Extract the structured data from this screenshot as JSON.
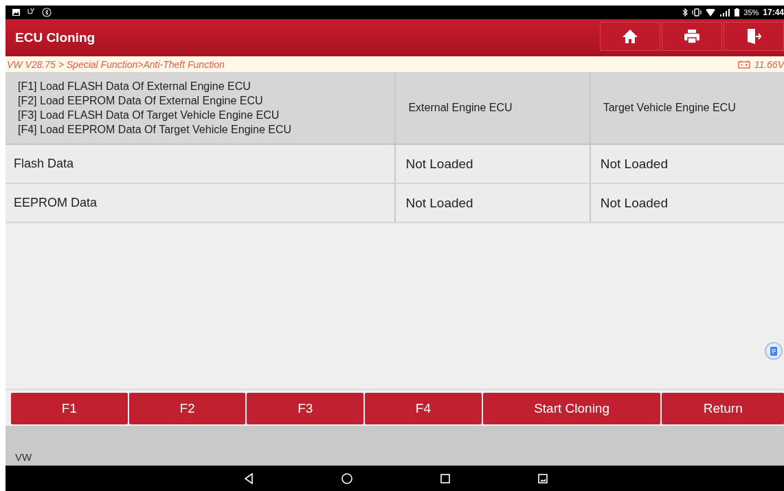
{
  "status_bar": {
    "battery": "35%",
    "time": "17:44"
  },
  "header": {
    "title": "ECU Cloning"
  },
  "breadcrumb": {
    "path": "VW V28.75 > Special Function>Anti-Theft Function",
    "voltage": "11.66V"
  },
  "table": {
    "header": {
      "lines": [
        "[F1] Load FLASH Data Of External Engine ECU",
        "[F2] Load EEPROM Data Of External Engine ECU",
        "[F3] Load FLASH Data Of Target Vehicle Engine ECU",
        "[F4] Load EEPROM Data Of Target Vehicle Engine ECU"
      ],
      "columns": [
        "External Engine ECU",
        "Target Vehicle Engine ECU"
      ]
    },
    "rows": [
      {
        "cells": [
          "Flash Data",
          "Not Loaded",
          "Not Loaded"
        ]
      },
      {
        "cells": [
          "EEPROM Data",
          "Not Loaded",
          "Not Loaded"
        ]
      }
    ]
  },
  "buttons": [
    "F1",
    "F2",
    "F3",
    "F4",
    "Start Cloning",
    "Return"
  ],
  "footer": {
    "label": "VW"
  }
}
